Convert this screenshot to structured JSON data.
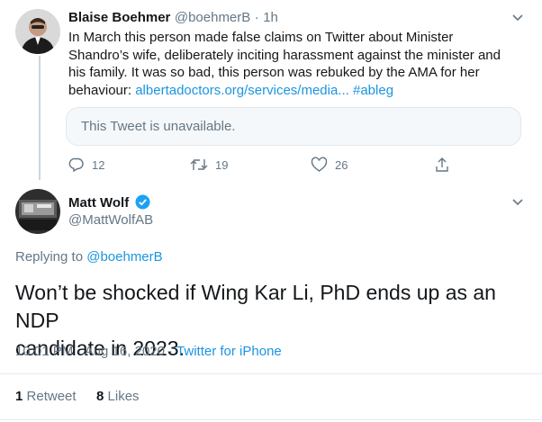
{
  "parent_tweet": {
    "name": "Blaise Boehmer",
    "handle": "@boehmerB",
    "sep": "·",
    "time": "1h",
    "text_lines": [
      "In March this person made false claims on Twitter about Minister",
      "Shandro’s wife, deliberately inciting harassment against the minister and",
      "his family. It was so bad, this person was rebuked by the AMA for her",
      "behaviour: "
    ],
    "link": "albertadoctors.org/services/media...",
    "hashtag": "#ableg",
    "quoted": "This Tweet is unavailable.",
    "replies": "12",
    "retweets": "19",
    "likes": "26"
  },
  "main_tweet": {
    "name": "Matt Wolf",
    "handle": "@MattWolfAB",
    "replying_prefix": "Replying to",
    "replying_handle": "@boehmerB",
    "text_line1": "Won’t be shocked if Wing Kar Li, PhD ends up as an NDP",
    "text_line2": "candidate in 2023.",
    "time": "10:01 PM · Aug 16, 2020",
    "sep": "·",
    "source": "Twitter for iPhone",
    "retweet_count": "1",
    "retweet_label": "Retweet",
    "like_count": "8",
    "like_label": "Likes"
  },
  "colors": {
    "accent": "#1b95e0",
    "secondary": "#657786",
    "border": "#e6ecf0"
  }
}
